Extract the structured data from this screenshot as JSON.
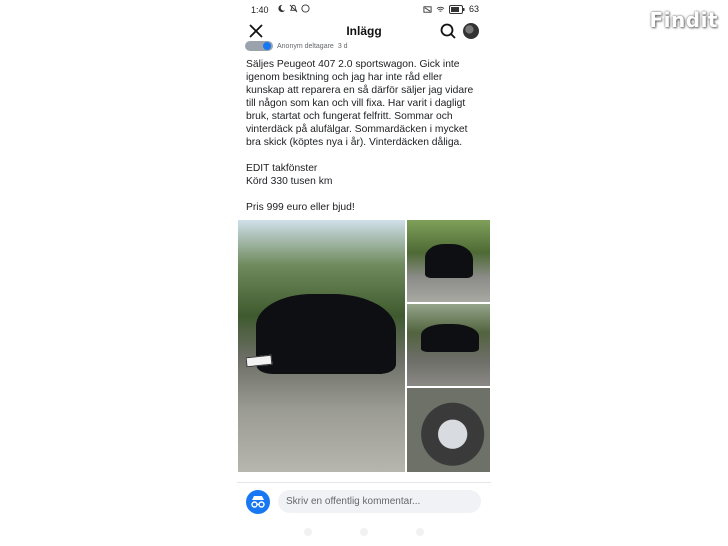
{
  "status_bar": {
    "time": "1:40",
    "battery": "63"
  },
  "app_bar": {
    "title": "Inlägg",
    "close_icon": "close-icon",
    "search_icon": "search-icon"
  },
  "author": {
    "name": "Anonym deltagare",
    "meta": "3 d"
  },
  "post": {
    "text": "Säljes Peugeot 407 2.0 sportswagon. Gick inte igenom besiktning och jag har inte råd eller kunskap att reparera en så därför säljer jag vidare till någon som kan och vill fixa. Har varit i dagligt bruk, startat och fungerat felfritt. Sommar och vinterdäck på alufälgar. Sommardäcken i mycket bra skick (köptes nya i år). Vinterdäcken dåliga.\n\nEDIT takfönster\nKörd 330 tusen km\n\nPris 999 euro eller bjud!"
  },
  "comment": {
    "placeholder": "Skriv en offentlig kommentar..."
  },
  "watermark": "Findit",
  "colors": {
    "accent": "#1877f2",
    "text": "#1c1e21",
    "muted": "#65676b",
    "input_bg": "#f0f2f5"
  }
}
